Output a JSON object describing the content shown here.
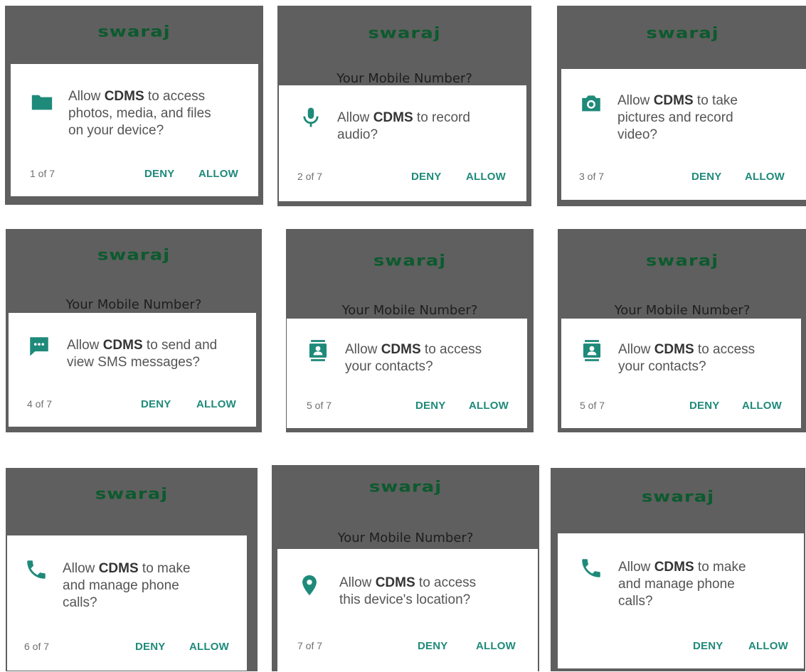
{
  "brand": "swaraj",
  "mobile_prompt": "Your Mobile Number?",
  "app_name": "CDMS",
  "msg_prefix": "Allow",
  "deny_label": "DENY",
  "allow_label": "ALLOW",
  "accent_color": "#1e8a7a",
  "panels": [
    {
      "icon": "folder-icon",
      "msg_line1_rest": "to access",
      "msg_rest": [
        "photos, media, and files",
        "on your device?"
      ],
      "count": "1 of 7",
      "show_mobile": false
    },
    {
      "icon": "microphone-icon",
      "msg_line1_rest": "to record",
      "msg_rest": [
        "audio?"
      ],
      "count": "2 of 7",
      "show_mobile": true
    },
    {
      "icon": "camera-icon",
      "msg_line1_rest": "to take",
      "msg_rest": [
        "pictures and record",
        "video?"
      ],
      "count": "3 of 7",
      "show_mobile": false
    },
    {
      "icon": "sms-icon",
      "msg_line1_rest": "to send and",
      "msg_rest": [
        "view SMS messages?"
      ],
      "count": "4 of 7",
      "show_mobile": true
    },
    {
      "icon": "contacts-icon",
      "msg_line1_rest": "to access",
      "msg_rest": [
        "your contacts?"
      ],
      "count": "5 of 7",
      "show_mobile": true
    },
    {
      "icon": "contacts-icon",
      "msg_line1_rest": "to access",
      "msg_rest": [
        "your contacts?"
      ],
      "count": "5 of 7",
      "show_mobile": true
    },
    {
      "icon": "phone-icon",
      "msg_line1_rest": "to make",
      "msg_rest": [
        "and manage phone",
        "calls?"
      ],
      "count": "6 of 7",
      "show_mobile": false
    },
    {
      "icon": "location-pin-icon",
      "msg_line1_rest": "to access",
      "msg_rest": [
        "this device's location?"
      ],
      "count": "7 of 7",
      "show_mobile": true
    },
    {
      "icon": "phone-icon",
      "msg_line1_rest": "to make",
      "msg_rest": [
        "and manage phone",
        "calls?"
      ],
      "count": "",
      "show_mobile": false
    }
  ]
}
